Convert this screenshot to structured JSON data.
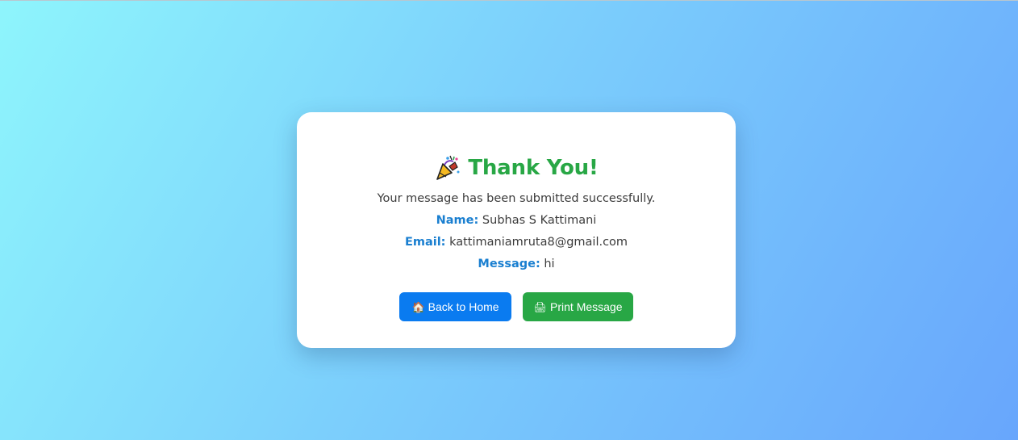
{
  "card": {
    "title": "Thank You!",
    "title_icon": "party-popper-icon",
    "subtitle": "Your message has been submitted successfully.",
    "fields": {
      "name_label": "Name:",
      "name_value": "Subhas S Kattimani",
      "email_label": "Email:",
      "email_value": "kattimaniamruta8@gmail.com",
      "message_label": "Message:",
      "message_value": "hi"
    }
  },
  "buttons": {
    "home_icon_glyph": "🏠",
    "home_label": "Back to Home",
    "print_icon_glyph": "🖨",
    "print_label": "Print Message"
  },
  "colors": {
    "title": "#28a745",
    "label": "#1a7fd0",
    "home_button": "#0a7bf0",
    "print_button": "#28a745"
  }
}
